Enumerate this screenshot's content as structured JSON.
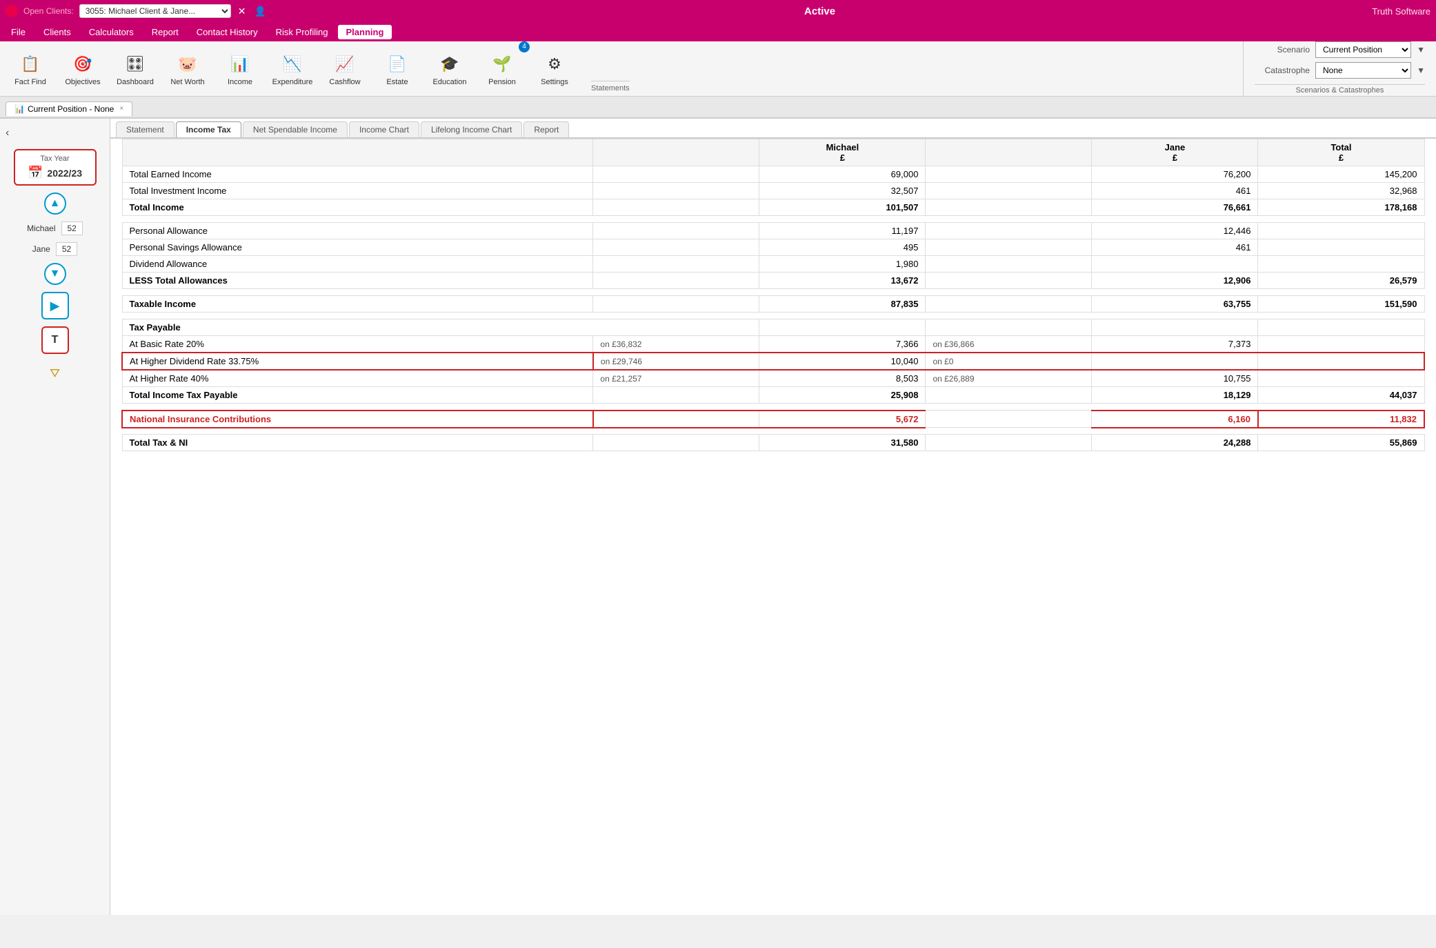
{
  "app": {
    "title": "Active",
    "brand": "Truth Software",
    "client_label": "Open Clients:",
    "client_value": "3055: Michael Client & Jane...",
    "active_tab": "Active"
  },
  "menu": {
    "items": [
      "File",
      "Clients",
      "Calculators",
      "Report",
      "Contact History",
      "Risk Profiling",
      "Planning"
    ],
    "active": "Planning"
  },
  "toolbar": {
    "tools": [
      {
        "id": "fact-find",
        "label": "Fact Find",
        "icon": "📋"
      },
      {
        "id": "objectives",
        "label": "Objectives",
        "icon": "🎯"
      },
      {
        "id": "dashboard",
        "label": "Dashboard",
        "icon": "🎛"
      },
      {
        "id": "net-worth",
        "label": "Net Worth",
        "icon": "🐷"
      },
      {
        "id": "income",
        "label": "Income",
        "icon": "📊"
      },
      {
        "id": "expenditure",
        "label": "Expenditure",
        "icon": "📉"
      },
      {
        "id": "cashflow",
        "label": "Cashflow",
        "icon": "📈"
      },
      {
        "id": "estate",
        "label": "Estate",
        "icon": "📄"
      },
      {
        "id": "education",
        "label": "Education",
        "icon": "🎓"
      },
      {
        "id": "pension",
        "label": "Pension",
        "icon": "🌱",
        "badge": "4"
      },
      {
        "id": "settings",
        "label": "Settings",
        "icon": "⚙"
      }
    ],
    "statements_label": "Statements"
  },
  "scenarios": {
    "label": "Scenario",
    "scenario_value": "Current Position",
    "catastrophe_label": "Catastrophe",
    "catastrophe_value": "None",
    "section_label": "Scenarios & Catastrophes"
  },
  "cp_tab": {
    "icon": "📊",
    "label": "Current Position - None",
    "close": "×"
  },
  "sidebar": {
    "collapse_icon": "‹",
    "tax_year_title": "Tax Year",
    "tax_year_value": "2022/23",
    "up_btn": "▲",
    "down_btn": "▼",
    "michael_label": "Michael",
    "michael_age": "52",
    "jane_label": "Jane",
    "jane_age": "52"
  },
  "content_tabs": [
    {
      "id": "statement",
      "label": "Statement",
      "active": false
    },
    {
      "id": "income-tax",
      "label": "Income Tax",
      "active": true
    },
    {
      "id": "net-spendable",
      "label": "Net Spendable Income",
      "active": false
    },
    {
      "id": "income-chart",
      "label": "Income Chart",
      "active": false
    },
    {
      "id": "lifelong",
      "label": "Lifelong Income Chart",
      "active": false
    },
    {
      "id": "report",
      "label": "Report",
      "active": false
    }
  ],
  "table": {
    "col_headers": [
      "",
      "",
      "Michael\n£",
      "",
      "Jane\n£",
      "Total\n£"
    ],
    "rows": [
      {
        "type": "data",
        "label": "Total Earned Income",
        "sub": "",
        "michael": "69,000",
        "jane": "76,200",
        "total": "145,200"
      },
      {
        "type": "data",
        "label": "Total Investment Income",
        "sub": "",
        "michael": "32,507",
        "jane": "461",
        "total": "32,968"
      },
      {
        "type": "bold",
        "label": "Total Income",
        "sub": "",
        "michael": "101,507",
        "jane": "76,661",
        "total": "178,168"
      },
      {
        "type": "gap"
      },
      {
        "type": "data",
        "label": "Personal Allowance",
        "sub": "",
        "michael": "11,197",
        "jane": "12,446",
        "total": ""
      },
      {
        "type": "data",
        "label": "Personal Savings Allowance",
        "sub": "",
        "michael": "495",
        "jane": "461",
        "total": ""
      },
      {
        "type": "data",
        "label": "Dividend Allowance",
        "sub": "",
        "michael": "1,980",
        "jane": "",
        "total": ""
      },
      {
        "type": "bold",
        "label": "LESS Total Allowances",
        "sub": "",
        "michael": "13,672",
        "jane": "12,906",
        "total": "26,579"
      },
      {
        "type": "gap"
      },
      {
        "type": "bold",
        "label": "Taxable Income",
        "sub": "",
        "michael": "87,835",
        "jane": "63,755",
        "total": "151,590"
      },
      {
        "type": "gap"
      },
      {
        "type": "bold-header",
        "label": "Tax Payable",
        "sub": "",
        "michael": "",
        "jane": "",
        "total": ""
      },
      {
        "type": "data",
        "label": "At Basic Rate 20%",
        "sub": "on £36,832",
        "michael": "7,366",
        "sub2": "on £36,866",
        "jane": "7,373",
        "total": ""
      },
      {
        "type": "highlight",
        "label": "At Higher Dividend Rate 33.75%",
        "sub": "on £29,746",
        "michael": "10,040",
        "sub2": "on £0",
        "jane": "",
        "total": ""
      },
      {
        "type": "data",
        "label": "At Higher Rate 40%",
        "sub": "on £21,257",
        "michael": "8,503",
        "sub2": "on £26,889",
        "jane": "10,755",
        "total": ""
      },
      {
        "type": "bold",
        "label": "Total Income Tax Payable",
        "sub": "",
        "michael": "25,908",
        "jane": "18,129",
        "total": "44,037"
      },
      {
        "type": "gap"
      },
      {
        "type": "ni",
        "label": "National Insurance Contributions",
        "sub": "",
        "michael": "5,672",
        "jane": "6,160",
        "total": "11,832"
      },
      {
        "type": "gap"
      },
      {
        "type": "bold",
        "label": "Total Tax & NI",
        "sub": "",
        "michael": "31,580",
        "jane": "24,288",
        "total": "55,869"
      }
    ]
  }
}
